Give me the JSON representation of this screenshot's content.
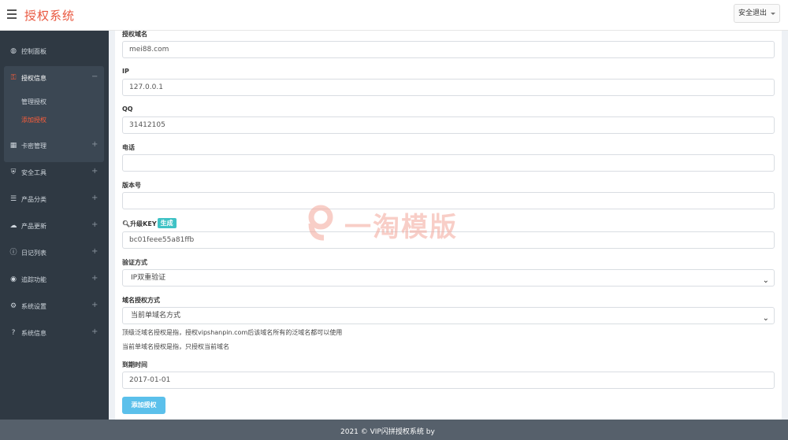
{
  "header": {
    "title": "授权系统",
    "logout_label": "安全退出"
  },
  "sidebar": {
    "items": [
      {
        "label": "控制面板",
        "icon": "dashboard-icon"
      },
      {
        "label": "授权信息",
        "icon": "key-icon",
        "toggle": "−"
      },
      {
        "label": "卡密管理",
        "icon": "qrcode-icon",
        "toggle": "+"
      },
      {
        "label": "安全工具",
        "icon": "shield-icon",
        "toggle": "+"
      },
      {
        "label": "产品分类",
        "icon": "list-icon",
        "toggle": "+"
      },
      {
        "label": "产品更新",
        "icon": "cloud-upload-icon",
        "toggle": "+"
      },
      {
        "label": "日记列表",
        "icon": "info-icon",
        "toggle": "+"
      },
      {
        "label": "追踪功能",
        "icon": "dot-circle-icon",
        "toggle": "+"
      },
      {
        "label": "系统设置",
        "icon": "gears-icon",
        "toggle": "+"
      },
      {
        "label": "系统信息",
        "icon": "question-icon",
        "toggle": "+"
      }
    ],
    "sub_items": [
      {
        "label": "管理授权"
      },
      {
        "label": "添加授权"
      }
    ]
  },
  "form": {
    "domain": {
      "label": "授权域名",
      "value": "mei88.com"
    },
    "ip": {
      "label": "IP",
      "value": "127.0.0.1"
    },
    "qq": {
      "label": "QQ",
      "value": "31412105"
    },
    "phone": {
      "label": "电话",
      "value": ""
    },
    "version": {
      "label": "版本号",
      "value": ""
    },
    "upgrade_key": {
      "label": "升级KEY",
      "generate_label": "生成",
      "value": "bc01feee55a81ffb"
    },
    "verify": {
      "label": "验证方式",
      "selected": "IP双重验证"
    },
    "domain_mode": {
      "label": "域名授权方式",
      "selected": "当前单域名方式"
    },
    "help_line1": "顶级泛域名授权是指，授权vipshanpin.com后该域名所有的泛域名都可以使用",
    "help_line2": "当前单域名授权是指，只授权当前域名",
    "expire": {
      "label": "到期时间",
      "value": "2017-01-01"
    },
    "submit_label": "添加授权"
  },
  "watermark": "一淘模版",
  "footer": {
    "text": "2021 © VIP闪拼授权系统 by"
  },
  "colors": {
    "brand": "#e9573f",
    "sidebar_bg": "#2f3943",
    "accent_active": "#ff5e3a",
    "submit": "#5bc0eb",
    "badge": "#3fc2c5"
  }
}
